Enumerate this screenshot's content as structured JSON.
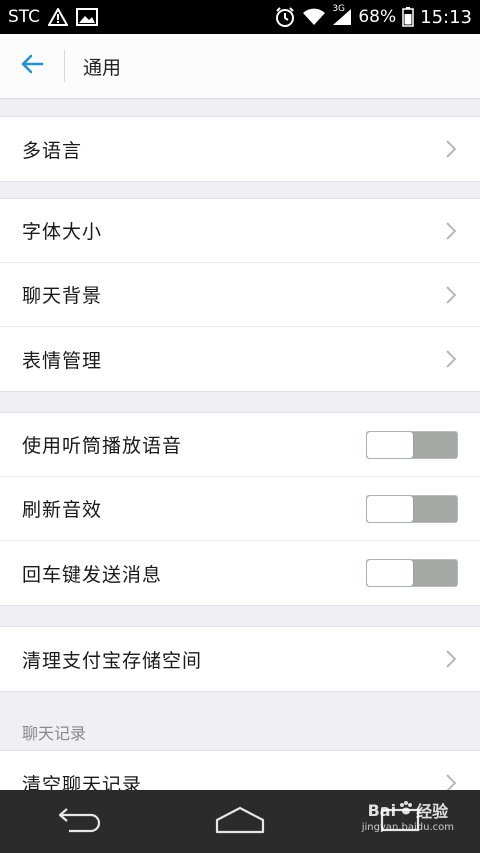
{
  "status_bar": {
    "carrier": "STC",
    "network": "3G",
    "battery": "68%",
    "time": "15:13"
  },
  "header": {
    "back_icon": "back-arrow-icon",
    "title": "通用"
  },
  "sections": [
    {
      "items": [
        {
          "label": "多语言",
          "type": "link"
        }
      ]
    },
    {
      "items": [
        {
          "label": "字体大小",
          "type": "link"
        },
        {
          "label": "聊天背景",
          "type": "link"
        },
        {
          "label": "表情管理",
          "type": "link"
        }
      ]
    },
    {
      "items": [
        {
          "label": "使用听筒播放语音",
          "type": "toggle",
          "on": false
        },
        {
          "label": "刷新音效",
          "type": "toggle",
          "on": false
        },
        {
          "label": "回车键发送消息",
          "type": "toggle",
          "on": false
        }
      ]
    },
    {
      "items": [
        {
          "label": "清理支付宝存储空间",
          "type": "link"
        }
      ]
    }
  ],
  "chat_history": {
    "header": "聊天记录",
    "items": [
      {
        "label": "清空聊天记录",
        "type": "link"
      }
    ]
  },
  "nav_bar": {
    "buttons": [
      "back-icon",
      "home-icon",
      "recent-apps-icon"
    ]
  },
  "watermark": {
    "text_logo": "Bai",
    "text_cn": "经验",
    "url": "jingyan.baidu.com"
  },
  "colors": {
    "accent": "#2a8fcf",
    "toggle_off": "#a5a9a5",
    "background": "#efeff4"
  }
}
